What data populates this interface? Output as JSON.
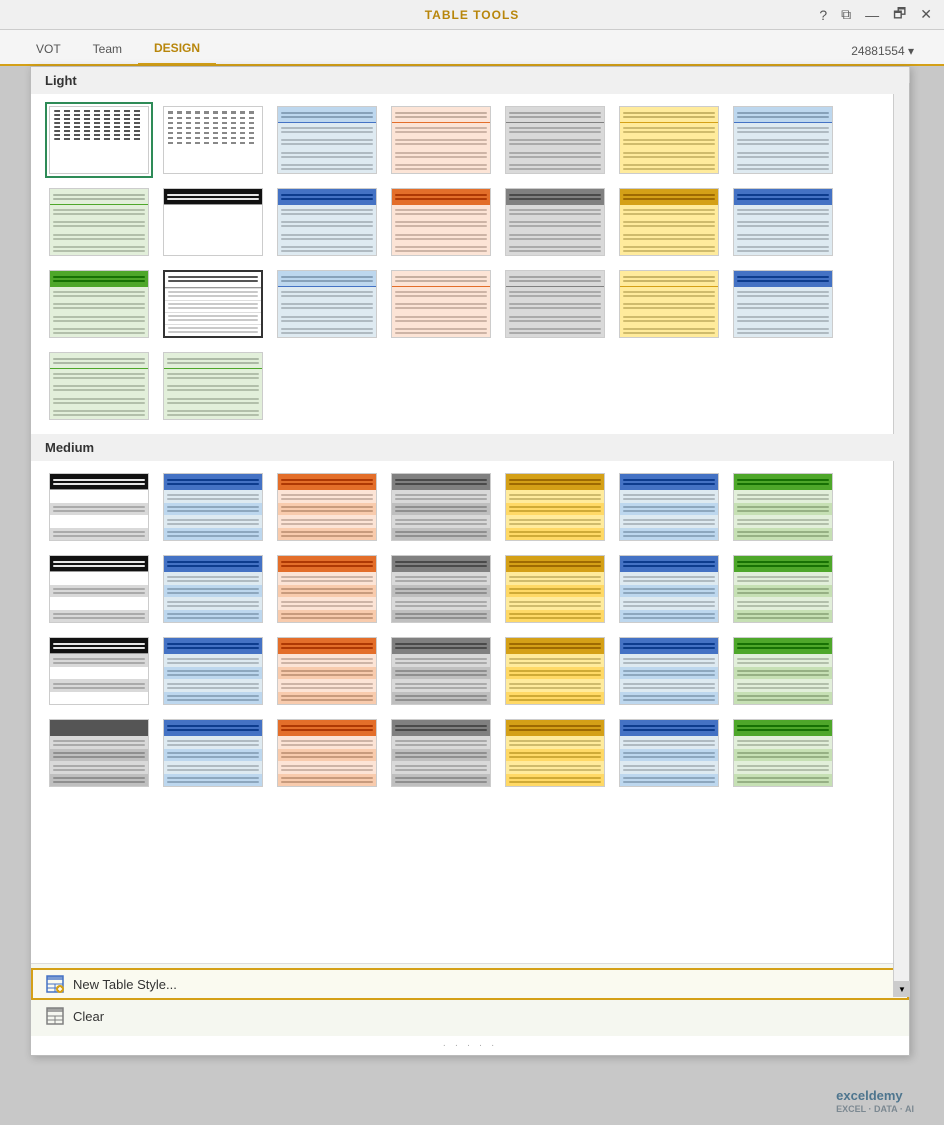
{
  "titleBar": {
    "tableTools": "TABLE TOOLS",
    "controls": [
      "?",
      "⧉",
      "—",
      "🗗",
      "✕"
    ]
  },
  "ribbonTabs": [
    {
      "label": "VOT",
      "active": false
    },
    {
      "label": "Team",
      "active": false
    },
    {
      "label": "DESIGN",
      "active": true
    }
  ],
  "userInfo": "24881554 ▾",
  "sections": [
    {
      "id": "light",
      "label": "Light",
      "styles": [
        {
          "id": "l1",
          "selected": true,
          "borderColor": "#2e8b57",
          "headerBg": "transparent",
          "rowBg": "transparent",
          "rowBg2": "transparent",
          "accentColor": "#333",
          "theme": "plain-dashed"
        },
        {
          "id": "l2",
          "selected": false,
          "headerBg": "transparent",
          "rowBg": "transparent",
          "accentColor": "#555",
          "theme": "plain-dashed-wide"
        },
        {
          "id": "l3",
          "selected": false,
          "headerBg": "#bdd7ee",
          "rowBg": "#deeaf1",
          "accentColor": "#4472c4",
          "theme": "blue-light"
        },
        {
          "id": "l4",
          "selected": false,
          "headerBg": "#fce4d6",
          "rowBg": "#fce4d6",
          "accentColor": "#e36e2a",
          "theme": "orange-light"
        },
        {
          "id": "l5",
          "selected": false,
          "headerBg": "#d9d9d9",
          "rowBg": "#d9d9d9",
          "accentColor": "#808080",
          "theme": "gray-light"
        },
        {
          "id": "l6",
          "selected": false,
          "headerBg": "#ffeb9c",
          "rowBg": "#ffeb9c",
          "accentColor": "#d4a017",
          "theme": "yellow-light"
        },
        {
          "id": "l7",
          "selected": false,
          "headerBg": "#bdd7ee",
          "rowBg": "#deeaf1",
          "accentColor": "#4472c4",
          "theme": "blue-light2"
        },
        {
          "id": "l8",
          "selected": false,
          "headerBg": "#e2efda",
          "rowBg": "#e2efda",
          "accentColor": "#4ea72a",
          "theme": "green-light-stripe"
        },
        {
          "id": "l9",
          "selected": false,
          "headerBg": "#111",
          "rowBg": "#fff",
          "accentColor": "#111",
          "theme": "black-header"
        },
        {
          "id": "l10",
          "selected": false,
          "headerBg": "#4472c4",
          "rowBg": "#deeaf1",
          "accentColor": "#4472c4",
          "theme": "blue-header"
        },
        {
          "id": "l11",
          "selected": false,
          "headerBg": "#e36e2a",
          "rowBg": "#fce4d6",
          "accentColor": "#e36e2a",
          "theme": "orange-header"
        },
        {
          "id": "l12",
          "selected": false,
          "headerBg": "#808080",
          "rowBg": "#d9d9d9",
          "accentColor": "#808080",
          "theme": "gray-header"
        },
        {
          "id": "l13",
          "selected": false,
          "headerBg": "#d4a017",
          "rowBg": "#ffeb9c",
          "accentColor": "#d4a017",
          "theme": "yellow-header"
        },
        {
          "id": "l14",
          "selected": false,
          "headerBg": "#4472c4",
          "rowBg": "#deeaf1",
          "accentColor": "#4472c4",
          "theme": "blue-header2"
        },
        {
          "id": "l15",
          "selected": false,
          "headerBg": "#4ea72a",
          "rowBg": "#e2efda",
          "accentColor": "#4ea72a",
          "theme": "green-header"
        },
        {
          "id": "l16",
          "selected": false,
          "headerBg": "transparent",
          "rowBg": "transparent",
          "border": "#555",
          "accentColor": "#333",
          "theme": "plain-border"
        },
        {
          "id": "l17",
          "selected": false,
          "headerBg": "#bdd7ee",
          "rowBg": "#deeaf1",
          "accentColor": "#4472c4",
          "theme": "blue-border"
        },
        {
          "id": "l18",
          "selected": false,
          "headerBg": "#fce4d6",
          "rowBg": "#fce4d6",
          "accentColor": "#e36e2a",
          "theme": "orange-border"
        },
        {
          "id": "l19",
          "selected": false,
          "headerBg": "#d9d9d9",
          "rowBg": "#d9d9d9",
          "accentColor": "#808080",
          "theme": "gray-border"
        },
        {
          "id": "l20",
          "selected": false,
          "headerBg": "#ffeb9c",
          "rowBg": "#ffeb9c",
          "accentColor": "#d4a017",
          "theme": "yellow-border"
        },
        {
          "id": "l21",
          "selected": false,
          "headerBg": "#4472c4",
          "rowBg": "#deeaf1",
          "accentColor": "#4472c4",
          "theme": "blue-border2"
        },
        {
          "id": "l22",
          "selected": false,
          "headerBg": "#e2efda",
          "rowBg": "#e2efda",
          "accentColor": "#4ea72a",
          "theme": "green-stripe2"
        },
        {
          "id": "l23",
          "selected": false,
          "headerBg": "#e2efda",
          "rowBg": "#e2efda",
          "accentColor": "#4ea72a",
          "theme": "green-full"
        }
      ]
    },
    {
      "id": "medium",
      "label": "Medium",
      "styles": [
        {
          "id": "m1",
          "headerBg": "#111",
          "rowBg": "#fff",
          "rowBg2": "#d9d9d9",
          "accentColor": "#111",
          "theme": "med-bw"
        },
        {
          "id": "m2",
          "headerBg": "#4472c4",
          "rowBg": "#deeaf1",
          "rowBg2": "#bdd7ee",
          "accentColor": "#4472c4",
          "theme": "med-blue"
        },
        {
          "id": "m3",
          "headerBg": "#e36e2a",
          "rowBg": "#fce4d6",
          "rowBg2": "#f8cbad",
          "accentColor": "#e36e2a",
          "theme": "med-orange"
        },
        {
          "id": "m4",
          "headerBg": "#808080",
          "rowBg": "#d9d9d9",
          "rowBg2": "#bfbfbf",
          "accentColor": "#808080",
          "theme": "med-gray"
        },
        {
          "id": "m5",
          "headerBg": "#d4a017",
          "rowBg": "#ffeb9c",
          "rowBg2": "#ffd966",
          "accentColor": "#d4a017",
          "theme": "med-yellow"
        },
        {
          "id": "m6",
          "headerBg": "#4472c4",
          "rowBg": "#deeaf1",
          "rowBg2": "#bdd7ee",
          "accentColor": "#4472c4",
          "theme": "med-blue2"
        },
        {
          "id": "m7",
          "headerBg": "#4ea72a",
          "rowBg": "#e2efda",
          "rowBg2": "#c6e0b4",
          "accentColor": "#4ea72a",
          "theme": "med-green"
        },
        {
          "id": "m8",
          "headerBg": "#111",
          "rowBg": "#fff",
          "rowBg2": "#d9d9d9",
          "accentColor": "#111",
          "theme": "med-bw2"
        },
        {
          "id": "m9",
          "headerBg": "#4472c4",
          "rowBg": "#deeaf1",
          "rowBg2": "#bdd7ee",
          "accentColor": "#4472c4",
          "theme": "med-blue3"
        },
        {
          "id": "m10",
          "headerBg": "#e36e2a",
          "rowBg": "#fce4d6",
          "rowBg2": "#f8cbad",
          "accentColor": "#e36e2a",
          "theme": "med-orange2"
        },
        {
          "id": "m11",
          "headerBg": "#808080",
          "rowBg": "#d9d9d9",
          "rowBg2": "#bfbfbf",
          "accentColor": "#808080",
          "theme": "med-gray2"
        },
        {
          "id": "m12",
          "headerBg": "#d4a017",
          "rowBg": "#ffeb9c",
          "rowBg2": "#ffd966",
          "accentColor": "#d4a017",
          "theme": "med-yellow2"
        },
        {
          "id": "m13",
          "headerBg": "#4472c4",
          "rowBg": "#deeaf1",
          "rowBg2": "#bdd7ee",
          "accentColor": "#4472c4",
          "theme": "med-blue4"
        },
        {
          "id": "m14",
          "headerBg": "#4ea72a",
          "rowBg": "#e2efda",
          "rowBg2": "#c6e0b4",
          "accentColor": "#4ea72a",
          "theme": "med-green2"
        },
        {
          "id": "m15",
          "headerBg": "#111",
          "rowBg": "#d9d9d9",
          "rowBg2": "#fff",
          "accentColor": "#555",
          "theme": "med-bw3"
        },
        {
          "id": "m16",
          "headerBg": "#4472c4",
          "rowBg": "#deeaf1",
          "rowBg2": "#bdd7ee",
          "accentColor": "#4472c4",
          "theme": "med-blue5"
        },
        {
          "id": "m17",
          "headerBg": "#e36e2a",
          "rowBg": "#fce4d6",
          "rowBg2": "#f8cbad",
          "accentColor": "#e36e2a",
          "theme": "med-orange3"
        },
        {
          "id": "m18",
          "headerBg": "#808080",
          "rowBg": "#d9d9d9",
          "rowBg2": "#bfbfbf",
          "accentColor": "#808080",
          "theme": "med-gray3"
        },
        {
          "id": "m19",
          "headerBg": "#d4a017",
          "rowBg": "#ffeb9c",
          "rowBg2": "#ffd966",
          "accentColor": "#d4a017",
          "theme": "med-yellow3"
        },
        {
          "id": "m20",
          "headerBg": "#4472c4",
          "rowBg": "#deeaf1",
          "rowBg2": "#bdd7ee",
          "accentColor": "#4472c4",
          "theme": "med-blue6"
        },
        {
          "id": "m21",
          "headerBg": "#4ea72a",
          "rowBg": "#e2efda",
          "rowBg2": "#c6e0b4",
          "accentColor": "#4ea72a",
          "theme": "med-green3"
        },
        {
          "id": "m22",
          "headerBg": "#555",
          "rowBg": "#d9d9d9",
          "rowBg2": "#bfbfbf",
          "accentColor": "#555",
          "theme": "med-bw4"
        },
        {
          "id": "m23",
          "headerBg": "#4472c4",
          "rowBg": "#deeaf1",
          "rowBg2": "#bdd7ee",
          "accentColor": "#4472c4",
          "theme": "med-blue7"
        },
        {
          "id": "m24",
          "headerBg": "#e36e2a",
          "rowBg": "#fce4d6",
          "rowBg2": "#f8cbad",
          "accentColor": "#e36e2a",
          "theme": "med-orange4"
        },
        {
          "id": "m25",
          "headerBg": "#808080",
          "rowBg": "#d9d9d9",
          "rowBg2": "#bfbfbf",
          "accentColor": "#808080",
          "theme": "med-gray4"
        },
        {
          "id": "m26",
          "headerBg": "#d4a017",
          "rowBg": "#ffeb9c",
          "rowBg2": "#ffd966",
          "accentColor": "#d4a017",
          "theme": "med-yellow4"
        },
        {
          "id": "m27",
          "headerBg": "#4472c4",
          "rowBg": "#deeaf1",
          "rowBg2": "#bdd7ee",
          "accentColor": "#4472c4",
          "theme": "med-blue8"
        },
        {
          "id": "m28",
          "headerBg": "#4ea72a",
          "rowBg": "#e2efda",
          "rowBg2": "#c6e0b4",
          "accentColor": "#4ea72a",
          "theme": "med-green4"
        }
      ]
    }
  ],
  "footer": {
    "newStyleLabel": "New Table Style...",
    "clearLabel": "Clear"
  },
  "scrollbar": {
    "upArrow": "▲",
    "downArrow": "▼"
  },
  "dots": "· · · · ·",
  "colors": {
    "accent": "#d4a017",
    "selectedBorder": "#2e8b57",
    "footerBg": "#f5f7f0",
    "panelBg": "#ffffff",
    "sectionBg": "#f0f0f0"
  }
}
